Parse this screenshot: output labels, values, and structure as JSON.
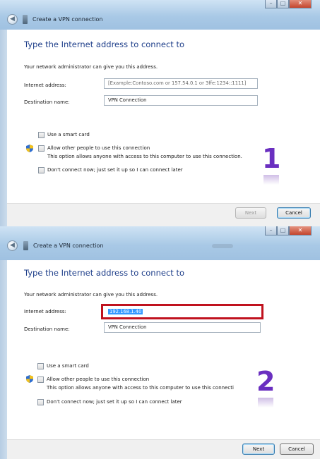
{
  "panels": [
    {
      "window_title": "Create a VPN connection",
      "heading": "Type the Internet address to connect to",
      "info": "Your network administrator can give you this address.",
      "internet_address_label": "Internet address:",
      "internet_address_value": "[Example:Contoso.com or 157.54.0.1 or 3ffe:1234::1111]",
      "destination_label": "Destination name:",
      "destination_value": "VPN Connection",
      "smart_card_label": "Use a smart card",
      "allow_others_label": "Allow other people to use this connection",
      "allow_others_desc": "This option allows anyone with access to this computer to use this connection.",
      "dont_connect_label": "Don't connect now; just set it up so I can connect later",
      "next_label": "Next",
      "cancel_label": "Cancel",
      "step_number": "1"
    },
    {
      "window_title": "Create a VPN connection",
      "heading": "Type the Internet address to connect to",
      "info": "Your network administrator can give you this address.",
      "internet_address_label": "Internet address:",
      "internet_address_value": "192.168.1.40",
      "destination_label": "Destination name:",
      "destination_value": "VPN Connection",
      "smart_card_label": "Use a smart card",
      "allow_others_label": "Allow other people to use this connection",
      "allow_others_desc": "This option allows anyone with access to this computer to use this connecti",
      "dont_connect_label": "Don't connect now; just set it up so I can connect later",
      "next_label": "Next",
      "cancel_label": "Cancel",
      "step_number": "2"
    }
  ],
  "colors": {
    "heading": "#1f3f8a",
    "highlight_box": "#c0121e",
    "step_number": "#6a2fc0",
    "selection": "#3399ff"
  }
}
